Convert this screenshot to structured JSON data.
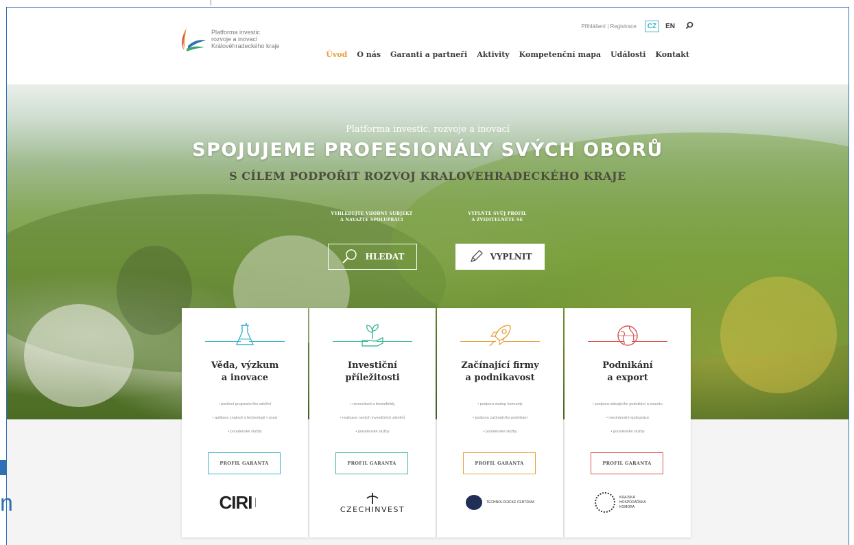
{
  "header": {
    "logo_lines": [
      "Platforma investic",
      "rozvoje a inovací",
      "Královéhradeckého kraje"
    ],
    "login_label": "Přihlášení | Registrace",
    "languages": [
      {
        "code": "CZ",
        "active": true
      },
      {
        "code": "EN",
        "active": false
      }
    ],
    "search_icon": "search-icon",
    "nav": [
      {
        "label": "Úvod",
        "active": true
      },
      {
        "label": "O nás",
        "active": false
      },
      {
        "label": "Garanti a partneři",
        "active": false
      },
      {
        "label": "Aktivity",
        "active": false
      },
      {
        "label": "Kompetenční mapa",
        "active": false
      },
      {
        "label": "Události",
        "active": false
      },
      {
        "label": "Kontakt",
        "active": false
      }
    ]
  },
  "hero": {
    "subtitle": "Platforma investic, rozvoje a inovací",
    "title": "SPOJUJEME PROFESIONÁLY SVÝCH OBORŮ",
    "title2": "S CÍLEM PODPOŘIT ROZVOJ KRALOVEHRADECKÉHO KRAJE",
    "cta_left_caption": [
      "VYHLEDEJTE VHODNÝ SUBJEKT",
      "A NAVAŽTE SPOLUPRÁCI"
    ],
    "cta_right_caption": [
      "VYPLŇTE SVŮJ PROFIL",
      "A ZVIDITELNĚTE SE"
    ],
    "btn_search": "HLEDAT",
    "btn_fill": "VYPLNIT"
  },
  "cards": [
    {
      "icon": "flask-icon",
      "color": "#3ab3c8",
      "title": [
        "Věda, výzkum",
        "a inovace"
      ],
      "items": [
        "• posilení progresivního odvětví",
        "• aplikace znalostí a technologií v praxi",
        "• poradenské služby"
      ],
      "button": "PROFIL GARANTA",
      "partner": "CIRI"
    },
    {
      "icon": "plant-hand-icon",
      "color": "#46b89a",
      "title": [
        "Investiční",
        "příležitosti"
      ],
      "items": [
        "• nemovitosti a brownfieldy",
        "• realizace nových investičních záměrů",
        "• poradenské služby"
      ],
      "button": "PROFIL GARANTA",
      "partner": "CZECHINVEST"
    },
    {
      "icon": "rocket-icon",
      "color": "#e8a13a",
      "title": [
        "Začínající firmy",
        "a podnikavost"
      ],
      "items": [
        "• podpora startup komunity",
        "• podpora začínajícího podnikání",
        "• poradenské služby"
      ],
      "button": "PROFIL GARANTA",
      "partner": "TECHNOLOGICKÉ CENTRUM"
    },
    {
      "icon": "globe-icon",
      "color": "#d9534f",
      "title": [
        "Podnikání",
        "a export"
      ],
      "items": [
        "• podpora stávajícího podnikání a exportu",
        "• mezinárodní spolupráce",
        "• poradenské služby"
      ],
      "button": "PROFIL GARANTA",
      "partner": "KRAJSKÁ HOSPODÁŘSKÁ KOMORA"
    }
  ]
}
